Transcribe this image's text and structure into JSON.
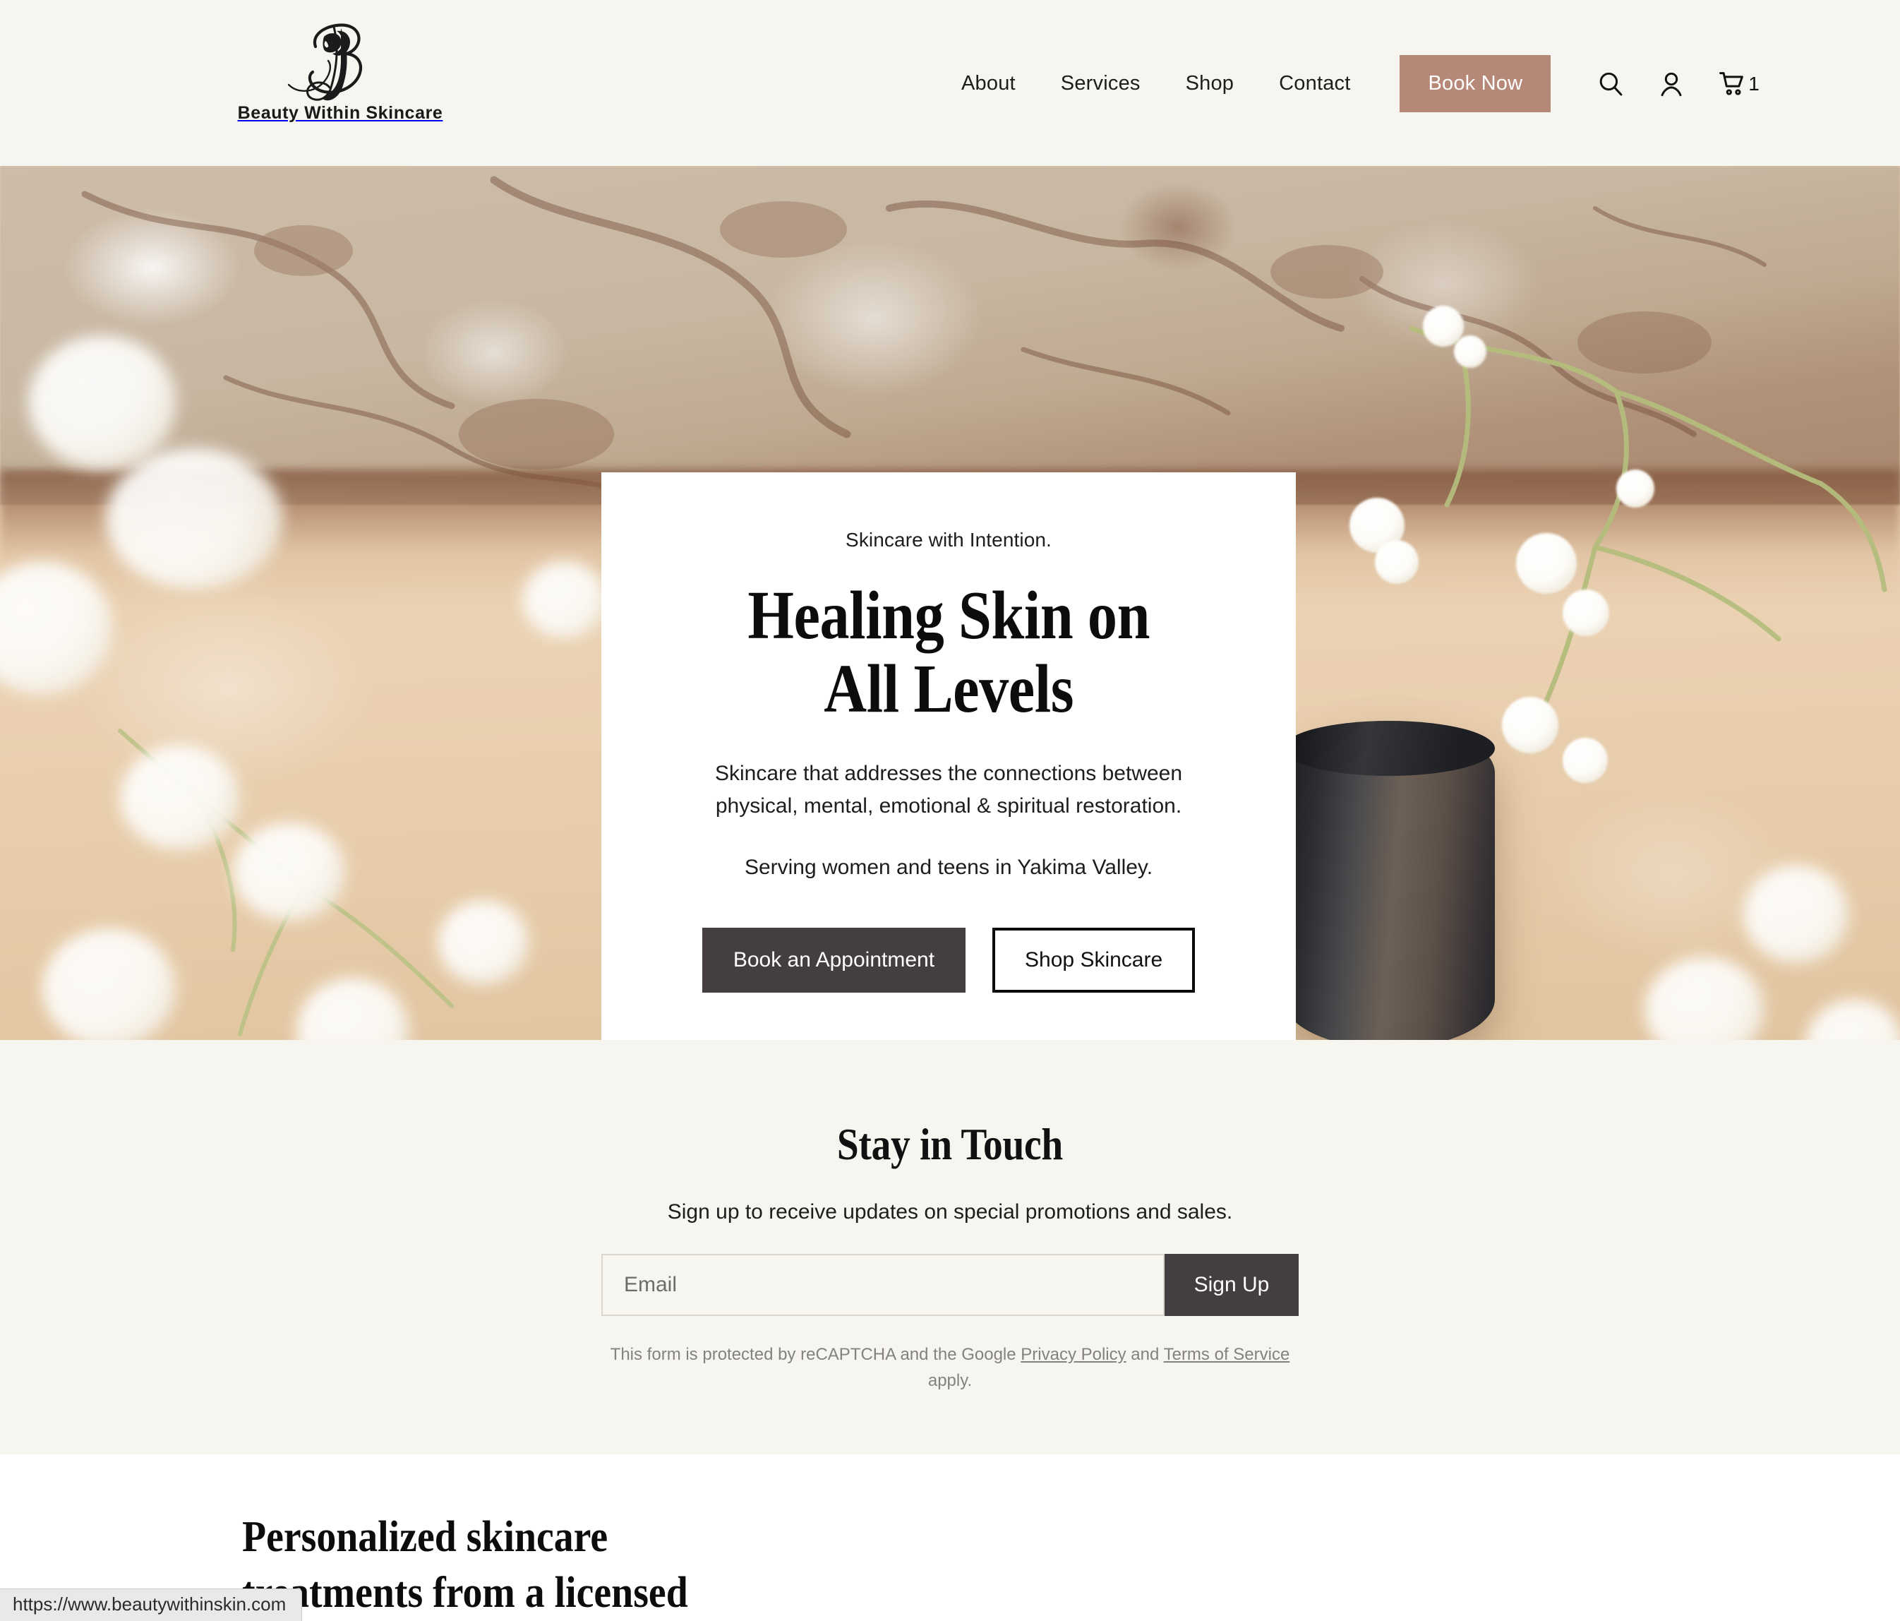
{
  "header": {
    "logo": {
      "icon": "script-b-woman-silhouette-logo",
      "text": "Beauty Within Skincare"
    },
    "nav": [
      {
        "label": "About"
      },
      {
        "label": "Services"
      },
      {
        "label": "Shop"
      },
      {
        "label": "Contact"
      }
    ],
    "book_now_label": "Book Now",
    "icons": {
      "search": "search-icon",
      "account": "account-icon",
      "cart": "cart-icon"
    },
    "cart_count": "1",
    "background_color": "#f7f5f0",
    "accent_color": "#b58878"
  },
  "hero": {
    "eyebrow": "Skincare with Intention.",
    "title_line1": "Healing Skin on",
    "title_line2": "All Levels",
    "subtitle": "Skincare that addresses the connections between physical, mental, emotional & spiritual restoration.",
    "subtitle2": "Serving women and teens in Yakima Valley.",
    "primary_button": "Book an Appointment",
    "secondary_button": "Shop Skincare",
    "primary_button_color": "#453e41",
    "card_background": "#ffffff",
    "image_description": "tree bark with white baby's breath flowers on tan background with black cosmetic jar"
  },
  "newsletter": {
    "title": "Stay in Touch",
    "subtitle": "Sign up to receive updates on special promotions and sales.",
    "email_placeholder": "Email",
    "email_value": "",
    "signup_label": "Sign Up",
    "recaptcha_prefix": "This form is protected by reCAPTCHA and the Google ",
    "privacy_link": "Privacy Policy",
    "recaptcha_mid": " and ",
    "terms_link": "Terms of Service",
    "recaptcha_suffix": " apply.",
    "background_color": "#f7f5f0"
  },
  "bottom": {
    "heading_line1": "Personalized skincare",
    "heading_line2": "treatments from a licensed"
  },
  "status_bar": {
    "url": "https://www.beautywithinskin.com"
  }
}
